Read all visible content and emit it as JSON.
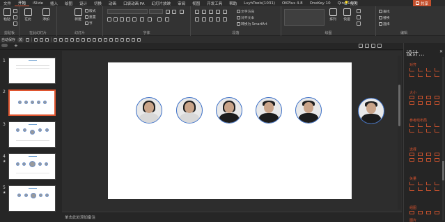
{
  "menu": {
    "items": [
      "文件",
      "开始",
      "iSlide",
      "插入",
      "绘图",
      "设计",
      "切换",
      "动画",
      "口袋动画 PA",
      "幻灯片放映",
      "审阅",
      "视图",
      "开发工具",
      "帮助",
      "LvyhTools(1031)",
      "OKPlus 4.8",
      "OneKey 10",
      "Qing 14.3"
    ],
    "active": "开始",
    "search_icon": "lightbulb-icon",
    "search_label": "搜索",
    "share_label": "共享",
    "share_icon": "share-icon",
    "accent": "#c4502d"
  },
  "ribbon": {
    "groups": {
      "clipboard": "剪贴板",
      "new_slides": "在此幻灯片",
      "slides": "幻灯片",
      "font": "字体",
      "paragraph": "段落",
      "drawing": "绘图",
      "editing": "编辑"
    },
    "paste_label": "粘贴",
    "new_slide_label": "在此\n幻灯片",
    "add_label": "添加\n幻灯片 + 插图",
    "new_label": "新建\n幻灯片",
    "layout_label": "版式",
    "reset_label": "重置",
    "section_label": "节",
    "find_label": "查找",
    "replace_label": "替换",
    "select_label": "选择",
    "arrange_label": "排列",
    "quick_styles_label": "快速样式",
    "text_direction_label": "文字方向",
    "align_text_label": "对齐文本",
    "smartart_label": "转换为 SmartArt"
  },
  "qat": {
    "autosave_label": "自动保存",
    "autosave_state": "关"
  },
  "tabstrip": {
    "add_label": "+"
  },
  "thumbnails": [
    {
      "num": "1",
      "star": ""
    },
    {
      "num": "2",
      "star": "",
      "selected": true
    },
    {
      "num": "3",
      "star": ""
    },
    {
      "num": "4",
      "star": "★"
    },
    {
      "num": "5",
      "star": "★"
    }
  ],
  "notes": {
    "placeholder": "单击此处添加备注"
  },
  "design_panel": {
    "title": "设计...",
    "close_icon": "close-icon",
    "sections": [
      "对齐",
      "大小",
      "参考线布局",
      "选择",
      "矢量",
      "组图",
      "图片"
    ]
  },
  "slide": {
    "avatars": [
      {
        "name": "avatar-woman-1",
        "hair": "long",
        "body": "light"
      },
      {
        "name": "avatar-woman-2",
        "hair": "long",
        "body": "light"
      },
      {
        "name": "avatar-woman-3",
        "hair": "long",
        "body": "dark"
      },
      {
        "name": "avatar-man-1",
        "hair": "short",
        "body": "dark"
      },
      {
        "name": "avatar-man-2",
        "hair": "short",
        "body": "dark"
      },
      {
        "name": "avatar-man-3-offslide",
        "hair": "short",
        "body": "dark"
      }
    ]
  }
}
